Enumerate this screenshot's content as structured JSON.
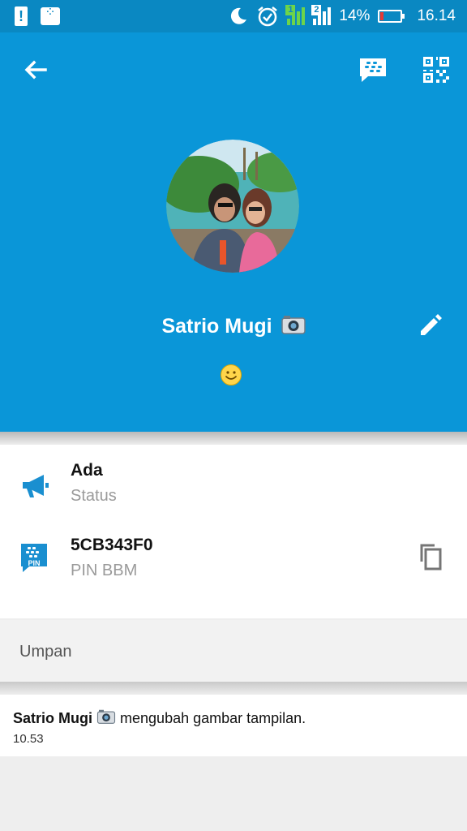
{
  "status_bar": {
    "battery_percent": "14%",
    "battery_level": 0.14,
    "time": "16.14",
    "sim1_label": "1",
    "sim2_label": "2",
    "battery_color": "#e53935",
    "icons": [
      "alert-icon",
      "bbm-notification-icon",
      "moon-icon",
      "alarm-icon",
      "signal-sim1-icon",
      "signal-sim2-icon",
      "battery-icon"
    ]
  },
  "header": {
    "background_color": "#0a96d8",
    "icons": [
      "back-arrow-icon",
      "bbm-chat-icon",
      "qr-code-icon",
      "edit-pencil-icon"
    ],
    "profile_name": "Satrio Mugi",
    "name_suffix_icon": "camera-icon",
    "status_emoji": "smiley-emoji"
  },
  "info": {
    "status_value": "Ada",
    "status_label": "Status",
    "pin_value": "5CB343F0",
    "pin_label": "PIN BBM",
    "pin_icon_text": "PIN",
    "accent_color": "#1a8fd0"
  },
  "feed": {
    "section_title": "Umpan",
    "items": [
      {
        "name": "Satrio Mugi",
        "action": "mengubah gambar tampilan.",
        "time": "10.53"
      }
    ]
  }
}
